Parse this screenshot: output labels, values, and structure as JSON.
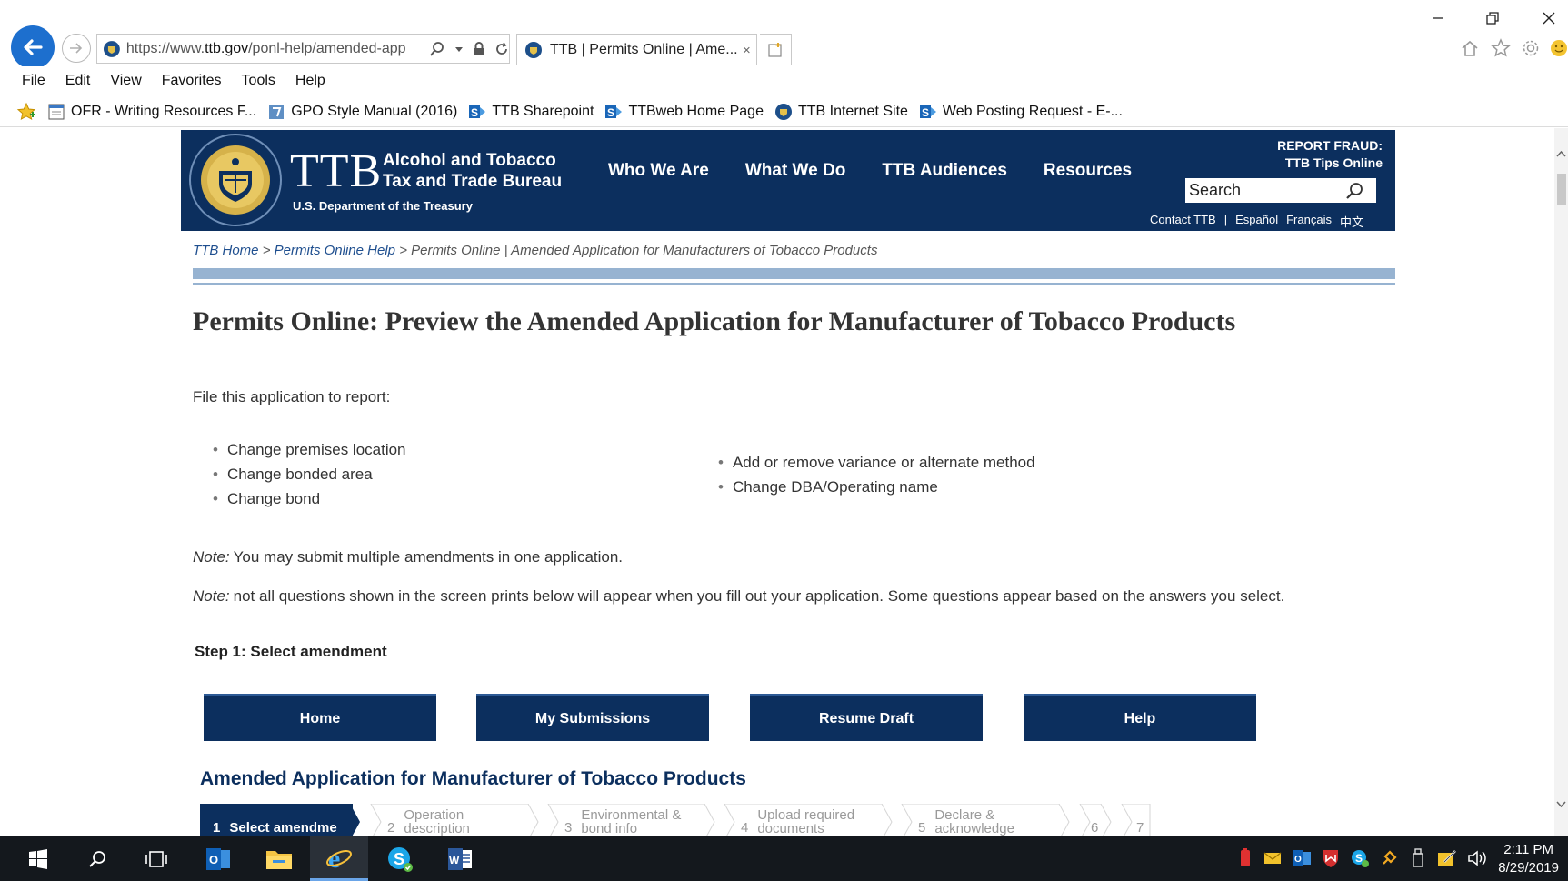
{
  "browser": {
    "url_prefix": "https://www.",
    "url_domain": "ttb.gov",
    "url_rest": "/ponl-help/amended-app",
    "tab_title": "TTB | Permits Online | Ame...",
    "tab_close": "×",
    "menu": [
      "File",
      "Edit",
      "View",
      "Favorites",
      "Tools",
      "Help"
    ],
    "favorites": [
      "OFR - Writing Resources F...",
      "GPO Style Manual (2016)",
      "TTB Sharepoint",
      "TTBweb Home Page",
      "TTB Internet Site",
      "Web Posting Request - E-..."
    ]
  },
  "site": {
    "logo_text": "TTB",
    "name_line1": "Alcohol and Tobacco",
    "name_line2": "Tax and Trade Bureau",
    "department": "U.S. Department of the Treasury",
    "nav": [
      "Who We Are",
      "What We Do",
      "TTB Audiences",
      "Resources"
    ],
    "fraud_line1": "REPORT FRAUD:",
    "fraud_line2": "TTB Tips Online",
    "search_placeholder": "Search",
    "util": [
      "Contact TTB",
      "|",
      "Español",
      "Français",
      "中文"
    ]
  },
  "breadcrumb": {
    "home": "TTB Home",
    "sep": ">",
    "help": "Permits Online Help",
    "current": "Permits Online | Amended Application for Manufacturers of Tobacco Products"
  },
  "content": {
    "title": "Permits Online: Preview the Amended Application for Manufacturer of Tobacco Products",
    "intro": "File this application to report:",
    "bullets_left": [
      "Change premises location",
      "Change bonded area",
      "Change bond"
    ],
    "bullets_right": [
      "Add or remove variance or alternate method",
      "Change DBA/Operating name"
    ],
    "note_label": "Note:",
    "note1": "You may submit multiple amendments in one application.",
    "note2": "not all questions shown in the screen prints below will appear when you fill out your application.  Some questions appear based on the answers you select.",
    "step_heading": "Step 1: Select amendment"
  },
  "app": {
    "buttons": [
      "Home",
      "My Submissions",
      "Resume Draft",
      "Help"
    ],
    "title": "Amended Application for Manufacturer of Tobacco Products",
    "steps": [
      {
        "num": "1",
        "label": "Select amendme"
      },
      {
        "num": "2",
        "label": "Operation description"
      },
      {
        "num": "3",
        "label": "Environmental & bond info"
      },
      {
        "num": "4",
        "label": "Upload required documents"
      },
      {
        "num": "5",
        "label": "Declare & acknowledge"
      },
      {
        "num": "6",
        "label": ""
      },
      {
        "num": "7",
        "label": ""
      }
    ]
  },
  "taskbar": {
    "time": "2:11 PM",
    "date": "8/29/2019"
  },
  "colors": {
    "ttb_navy": "#0c2f5e",
    "rule_blue": "#97b3d1",
    "ie_blue": "#1d6fce"
  }
}
